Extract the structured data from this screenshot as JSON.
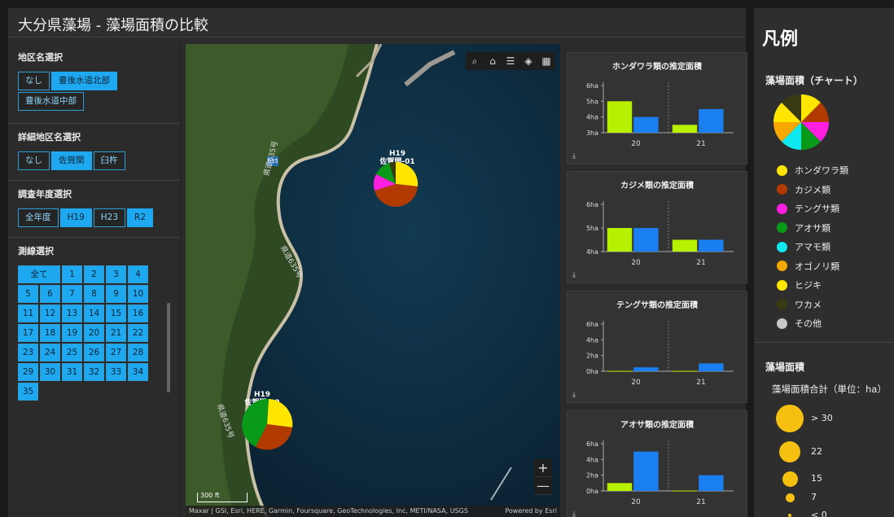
{
  "title": "大分県藻場 - 藻場面積の比較",
  "filters": {
    "area": {
      "label": "地区名選択",
      "options": [
        "なし",
        "豊後水道北部",
        "豊後水道中部"
      ],
      "selected": [
        1
      ]
    },
    "subarea": {
      "label": "詳細地区名選択",
      "options": [
        "なし",
        "佐賀関",
        "臼杵"
      ],
      "selected": [
        1
      ]
    },
    "year": {
      "label": "調査年度選択",
      "options": [
        "全年度",
        "H19",
        "H23",
        "R2"
      ],
      "selected": [
        1,
        3
      ]
    },
    "line": {
      "label": "測線選択",
      "all_label": "全て",
      "numbers": [
        "1",
        "2",
        "3",
        "4",
        "5",
        "6",
        "7",
        "8",
        "9",
        "10",
        "11",
        "12",
        "13",
        "14",
        "15",
        "16",
        "17",
        "18",
        "19",
        "20",
        "21",
        "22",
        "23",
        "24",
        "25",
        "26",
        "27",
        "28",
        "29",
        "30",
        "31",
        "32",
        "33",
        "34",
        "35"
      ]
    }
  },
  "map": {
    "attribution": "Maxar | GSI, Esri, HERE, Garmin, Foursquare, GeoTechnologies, Inc, METI/NASA, USGS",
    "powered_by": "Powered by Esri",
    "scale_label": "300 ft",
    "road_label": "県道635号",
    "route_label": "635",
    "markers": [
      {
        "label_year": "H19",
        "label_name": "佐賀関-01"
      },
      {
        "label_year": "H19",
        "label_name": "佐賀関-02"
      }
    ],
    "zoom_in": "+",
    "zoom_out": "—"
  },
  "chart_data": [
    {
      "type": "bar",
      "title": "ホンダワラ類の推定面積",
      "categories": [
        "20",
        "21"
      ],
      "yticks": [
        "3ha",
        "4ha",
        "5ha",
        "6ha"
      ],
      "ylim": [
        3,
        6
      ],
      "series": [
        {
          "values": [
            5.0,
            3.5
          ],
          "color": "#b7f000"
        },
        {
          "values": [
            4.0,
            4.5
          ],
          "color": "#1a7ff0"
        }
      ]
    },
    {
      "type": "bar",
      "title": "カジメ類の推定面積",
      "categories": [
        "20",
        "21"
      ],
      "yticks": [
        "4ha",
        "5ha",
        "6ha"
      ],
      "ylim": [
        4,
        6
      ],
      "series": [
        {
          "values": [
            5.0,
            4.5
          ],
          "color": "#b7f000"
        },
        {
          "values": [
            5.0,
            4.5
          ],
          "color": "#1a7ff0"
        }
      ]
    },
    {
      "type": "bar",
      "title": "テングサ類の推定面積",
      "categories": [
        "20",
        "21"
      ],
      "yticks": [
        "0ha",
        "2ha",
        "4ha",
        "6ha"
      ],
      "ylim": [
        0,
        6
      ],
      "series": [
        {
          "values": [
            0.05,
            0.05
          ],
          "color": "#b7f000"
        },
        {
          "values": [
            0.5,
            1.0
          ],
          "color": "#1a7ff0"
        }
      ]
    },
    {
      "type": "bar",
      "title": "アオサ類の推定面積",
      "categories": [
        "20",
        "21"
      ],
      "yticks": [
        "0ha",
        "2ha",
        "4ha",
        "6ha"
      ],
      "ylim": [
        0,
        6
      ],
      "series": [
        {
          "values": [
            1.0,
            0.05
          ],
          "color": "#b7f000"
        },
        {
          "values": [
            5.0,
            2.0
          ],
          "color": "#1a7ff0"
        }
      ]
    }
  ],
  "legend": {
    "title": "凡例",
    "pie_heading": "藻場面積（チャート）",
    "items": [
      {
        "label": "ホンダワラ類",
        "color": "#ffe600"
      },
      {
        "label": "カジメ類",
        "color": "#b23a00"
      },
      {
        "label": "テングサ類",
        "color": "#ff1ee0"
      },
      {
        "label": "アオサ類",
        "color": "#0a9a1a"
      },
      {
        "label": "アマモ類",
        "color": "#10e8f0"
      },
      {
        "label": "オゴノリ類",
        "color": "#f5a800"
      },
      {
        "label": "ヒジキ",
        "color": "#ffe600"
      },
      {
        "label": "ワカメ",
        "color": "#3a3a10"
      },
      {
        "label": "その他",
        "color": "#c8c8c8"
      }
    ],
    "size_heading": "藻場面積",
    "size_sub": "藻場面積合計（単位：ha）",
    "sizes": [
      {
        "label": "> 30",
        "d": 34
      },
      {
        "label": "22",
        "d": 26
      },
      {
        "label": "15",
        "d": 19
      },
      {
        "label": "7",
        "d": 11
      },
      {
        "label": "< 0",
        "d": 4
      }
    ]
  }
}
